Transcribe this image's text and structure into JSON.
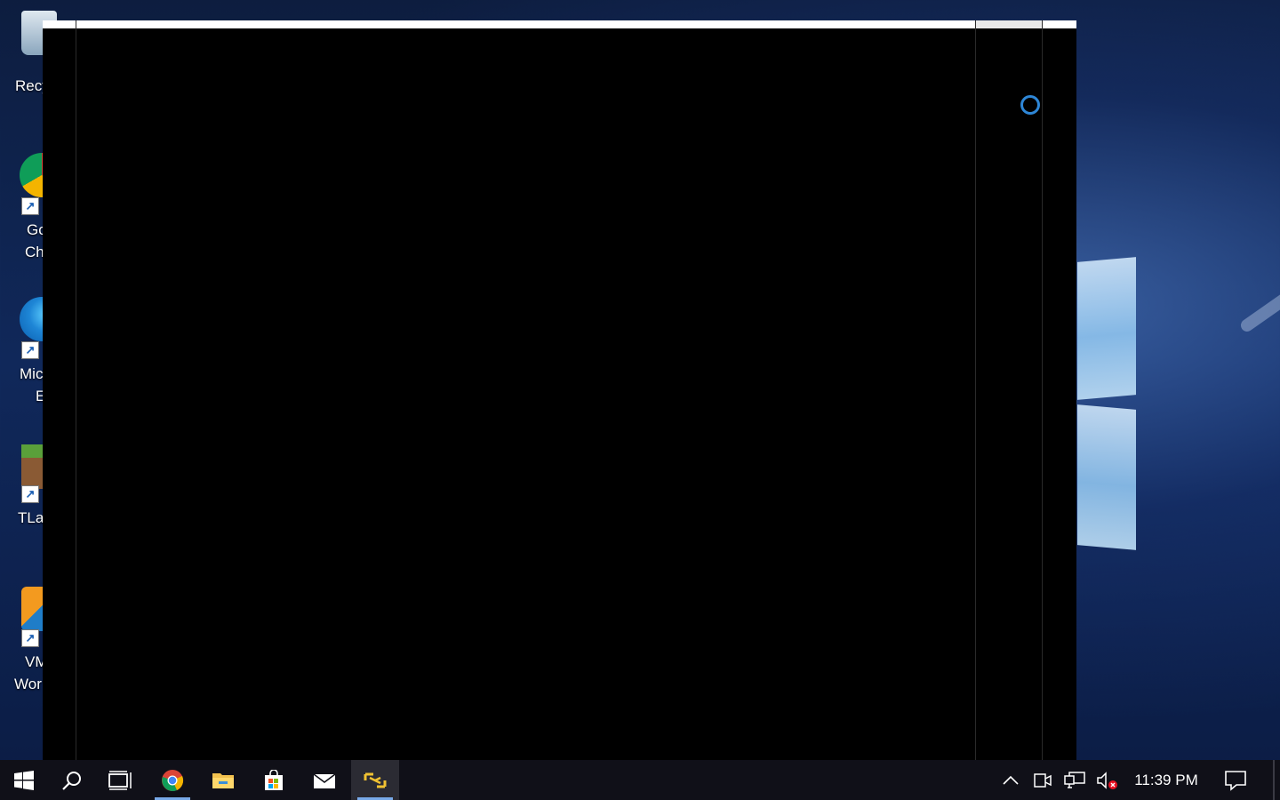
{
  "desktop": {
    "icons": [
      {
        "label_line1": "Recy",
        "label_line2": ""
      },
      {
        "label_line1": "Gc",
        "label_line2": "Ch"
      },
      {
        "label_line1": "Mic",
        "label_line2": "E"
      },
      {
        "label_line1": "TLa",
        "label_line2": ""
      },
      {
        "label_line1": "VM",
        "label_line2": "Wor"
      }
    ]
  },
  "taskbar": {
    "clock": "11:39 PM",
    "pinned": [
      {
        "icon": "windows-start-icon"
      },
      {
        "icon": "search-icon"
      },
      {
        "icon": "task-view-icon"
      },
      {
        "icon": "chrome-icon"
      },
      {
        "icon": "file-explorer-icon"
      },
      {
        "icon": "microsoft-store-icon"
      },
      {
        "icon": "mail-icon"
      },
      {
        "icon": "vmware-icon"
      }
    ],
    "tray": [
      "chevron-up-icon",
      "meet-now-icon",
      "network-icon",
      "volume-muted-icon"
    ]
  },
  "colors": {
    "accent": "#2e86d6",
    "taskbar": "#101018"
  }
}
